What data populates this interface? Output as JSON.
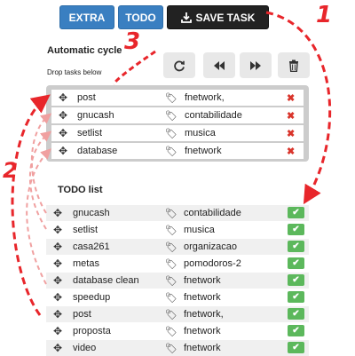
{
  "toolbar": {
    "extra_label": "EXTRA",
    "todo_label": "TODO",
    "save_label": "SAVE TASK"
  },
  "cycle": {
    "title": "Automatic cycle",
    "subtitle": "Drop tasks below",
    "rows": [
      {
        "name": "post",
        "project": "fnetwork,"
      },
      {
        "name": "gnucash",
        "project": "contabilidade"
      },
      {
        "name": "setlist",
        "project": "musica"
      },
      {
        "name": "database",
        "project": "fnetwork"
      }
    ]
  },
  "todo": {
    "title": "TODO list",
    "rows": [
      {
        "name": "gnucash",
        "project": "contabilidade"
      },
      {
        "name": "setlist",
        "project": "musica"
      },
      {
        "name": "casa261",
        "project": "organizacao"
      },
      {
        "name": "metas",
        "project": "pomodoros-2"
      },
      {
        "name": "database clean",
        "project": "fnetwork"
      },
      {
        "name": "speedup",
        "project": "fnetwork"
      },
      {
        "name": "post",
        "project": "fnetwork,"
      },
      {
        "name": "proposta",
        "project": "fnetwork"
      },
      {
        "name": "video",
        "project": "fnetwork"
      }
    ]
  },
  "annotations": {
    "one": "1",
    "two": "2",
    "three": "3"
  },
  "icons": {
    "download": "download-icon",
    "refresh": "refresh-icon",
    "backward": "backward-icon",
    "forward": "forward-icon",
    "trash": "trash-icon",
    "move": "move-icon",
    "tag": "tag-icon",
    "remove": "remove-icon",
    "check": "check-icon"
  },
  "colors": {
    "primary_button": "#3a7fc1",
    "save_button": "#222222",
    "remove": "#d9342b",
    "done": "#5cb85c",
    "annotation": "#e8262b"
  }
}
